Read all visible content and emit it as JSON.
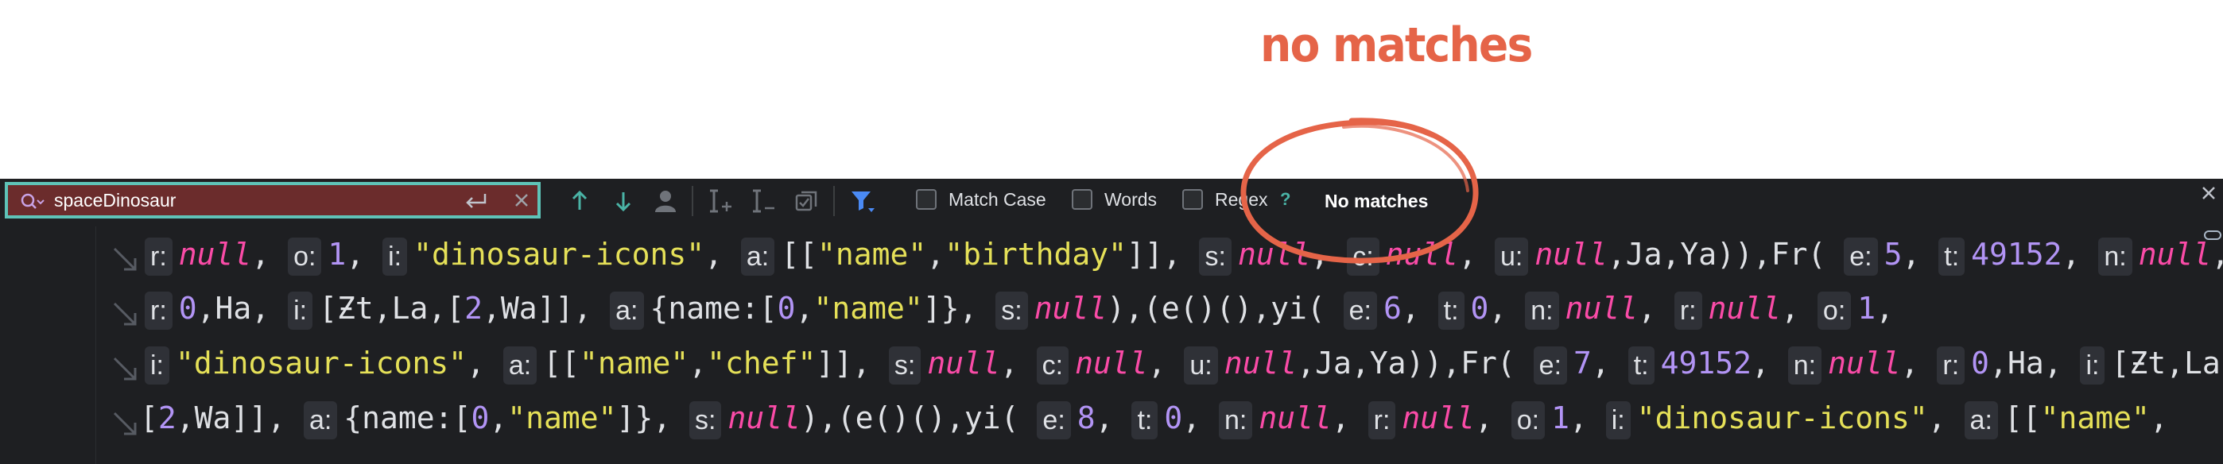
{
  "annotation": {
    "text": "no matches",
    "color": "#e56448"
  },
  "findbar": {
    "search_value": "spaceDinosaur",
    "match_case_label": "Match Case",
    "words_label": "Words",
    "regex_label": "Regex",
    "help_label": "?",
    "status_text": "No matches",
    "icons": {
      "search": "search-history-icon",
      "enter": "enter-newline-icon",
      "clear": "clear-icon",
      "prev": "arrow-up-icon",
      "next": "arrow-down-icon",
      "user": "user-icon",
      "add_occurrence": "add-occurrence-icon",
      "remove_occurrence": "remove-occurrence-icon",
      "select_all": "select-all-occurrences-icon",
      "filter": "filter-icon",
      "close": "close-icon"
    }
  },
  "editor": {
    "lines": [
      "r: null, o: 1, i: \"dinosaur-icons\", a: [[\"name\",\"birthday\"]], s: null, c: null, u: null,Ja,Ya)),Fr( e: 5, t: 49152, n: null,",
      "r: 0,Ha, i: [Ƶt,La,[2,Wa]], a: {name:[0,\"name\"]}, s: null),(e()(),yi( e: 6, t: 0, n: null, r: null, o: 1,",
      "i: \"dinosaur-icons\", a: [[\"name\",\"chef\"]], s: null, c: null, u: null,Ja,Ya)),Fr( e: 7, t: 49152, n: null, r: 0,Ha, i: [Ƶt,La,",
      "[2,Wa]], a: {name:[0,\"name\"]}, s: null),(e()(),yi( e: 8, t: 0, n: null, r: null, o: 1, i: \"dinosaur-icons\", a: [[\"name\","
    ]
  },
  "colors": {
    "search_error_bg": "#6b2c2c",
    "search_border": "#5ec3b8",
    "keyword": "#fa4ba7",
    "number": "#b294f5",
    "string": "#e5e058",
    "editor_bg": "#1e1f22"
  }
}
